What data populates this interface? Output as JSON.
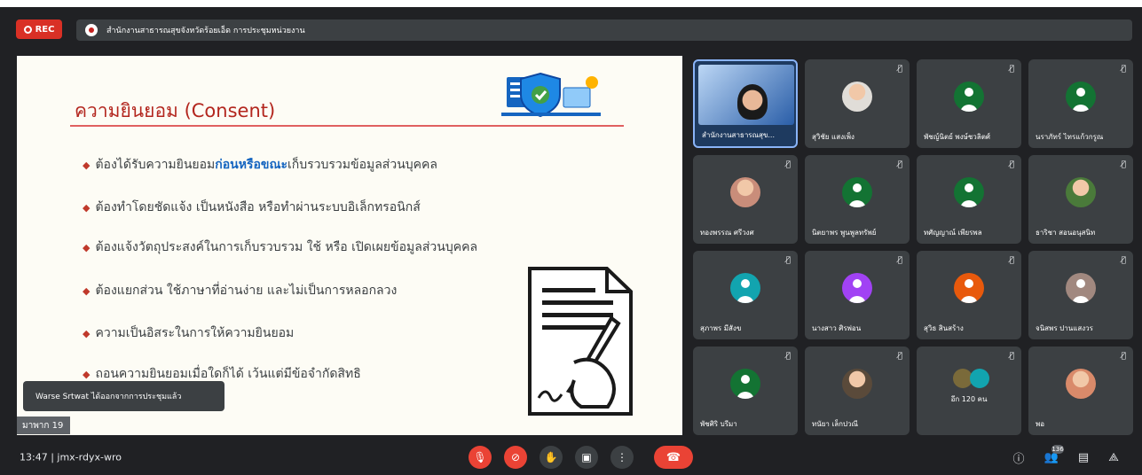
{
  "recording": {
    "label": "REC"
  },
  "meeting_title": "สำนักงานสาธารณสุขจังหวัดร้อยเอ็ด การประชุมหน่วยงาน",
  "slide": {
    "title": "ความยินยอม (Consent)",
    "bullets": [
      {
        "pre": "ต้องได้รับความยินยอม",
        "bold": "ก่อนหรือขณะ",
        "post": "เก็บรวบรวมข้อมูลส่วนบุคคล"
      },
      {
        "pre": "ต้องทำโดยชัดแจ้ง เป็นหนังสือ หรือทำผ่านระบบอิเล็กทรอนิกส์",
        "bold": "",
        "post": ""
      },
      {
        "pre": "ต้องแจ้งวัตถุประสงค์ในการเก็บรวบรวม ใช้ หรือ เปิดเผยข้อมูลส่วนบุคคล",
        "bold": "",
        "post": ""
      },
      {
        "pre": "ต้องแยกส่วน ใช้ภาษาที่อ่านง่าย และไม่เป็นการหลอกลวง",
        "bold": "",
        "post": ""
      },
      {
        "pre": "ความเป็นอิสระในการให้ความยินยอม",
        "bold": "",
        "post": ""
      },
      {
        "pre": "ถอนความยินยอมเมื่อใดก็ได้ เว้นแต่มีข้อจำกัดสิทธิ",
        "bold": "",
        "post": ""
      }
    ],
    "page_label": "มาพาก 19"
  },
  "toast": "Warse Srtwat ได้ออกจากการประชุมแล้ว",
  "participants": [
    {
      "name": "สำนักงานสาธารณสุข...",
      "kind": "speaker"
    },
    {
      "name": "สุวิชัย แสงเพ็ง",
      "kind": "photo",
      "color": "#e0ddd8"
    },
    {
      "name": "พัชญ์นิตย์ พงษ์ชวลิตศ์",
      "kind": "avatar",
      "color": "#137333"
    },
    {
      "name": "นราภัทร์ ไทรแก้วกรูณ",
      "kind": "avatar",
      "color": "#137333"
    },
    {
      "name": "ทองพรรณ ศรีวงศ",
      "kind": "photo",
      "color": "#c98d7a"
    },
    {
      "name": "นิตยาพร พูนพูลทรัพย์",
      "kind": "avatar",
      "color": "#137333"
    },
    {
      "name": "ทศัญญาณ์ เพียรพล",
      "kind": "avatar",
      "color": "#137333"
    },
    {
      "name": "ธาริชา สอนอนุสนิท",
      "kind": "photo",
      "color": "#4a7a3a"
    },
    {
      "name": "สุภาพร มีสังข",
      "kind": "avatar",
      "color": "#12a4af"
    },
    {
      "name": "นางสาว ศิรพ่อน",
      "kind": "avatar",
      "color": "#a142f4"
    },
    {
      "name": "สุวิธ สินสร้าง",
      "kind": "avatar",
      "color": "#e8590c"
    },
    {
      "name": "จนิสพร ปานแสงวร",
      "kind": "avatar",
      "color": "#a1887f"
    },
    {
      "name": "พัชศิริ บรีมา",
      "kind": "avatar",
      "color": "#137333"
    },
    {
      "name": "ทนัยา เล็กปวณี",
      "kind": "photo",
      "color": "#5a4a3a"
    },
    {
      "name": "อีก 120 คน",
      "kind": "others",
      "color": "#12a4af"
    },
    {
      "name": "พอ",
      "kind": "photo",
      "color": "#d98a6a"
    }
  ],
  "meeting_code": "13:47  |  jmx-rdyx-wro",
  "people_count": "136"
}
